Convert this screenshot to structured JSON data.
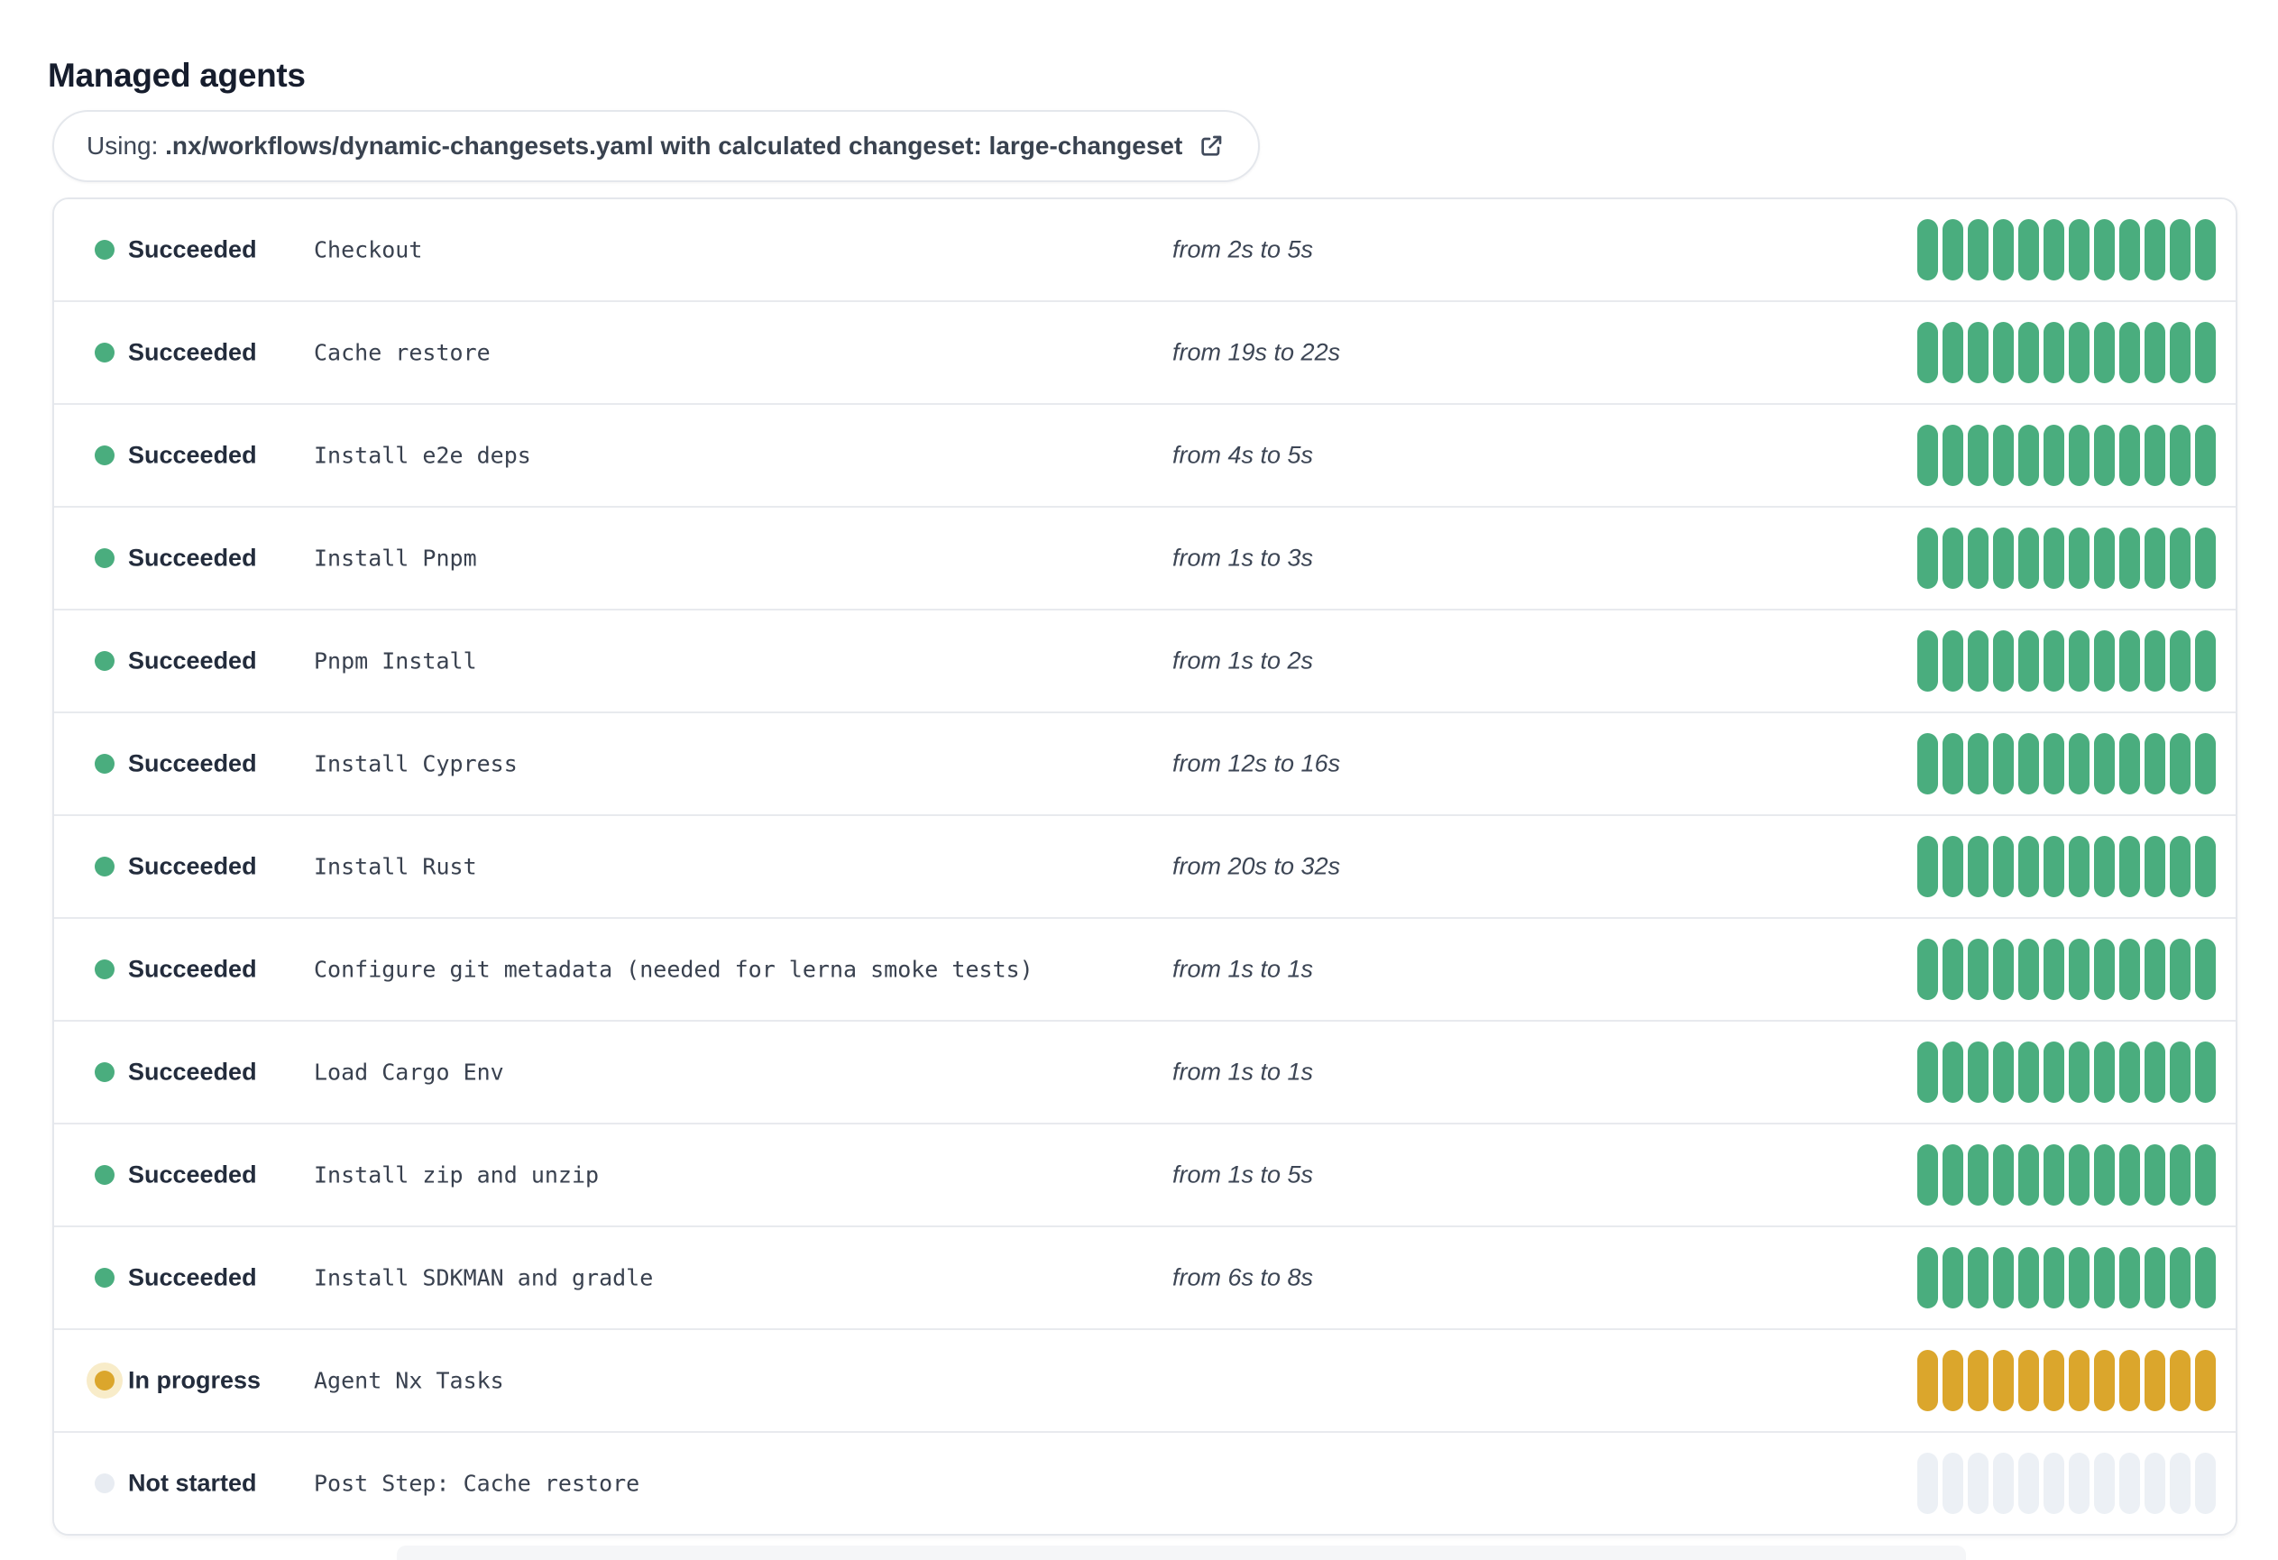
{
  "page": {
    "title": "Managed agents"
  },
  "banner": {
    "prefix": "Using: ",
    "detail": ".nx/workflows/dynamic-changesets.yaml with calculated changeset: large-changeset",
    "icon": "external-link-icon"
  },
  "agents": {
    "segments_per_row": 12,
    "rows": [
      {
        "status_label": "Succeeded",
        "status": "succeeded",
        "step": "Checkout",
        "duration": "from 2s to 5s"
      },
      {
        "status_label": "Succeeded",
        "status": "succeeded",
        "step": "Cache restore",
        "duration": "from 19s to 22s"
      },
      {
        "status_label": "Succeeded",
        "status": "succeeded",
        "step": "Install e2e deps",
        "duration": "from 4s to 5s"
      },
      {
        "status_label": "Succeeded",
        "status": "succeeded",
        "step": "Install Pnpm",
        "duration": "from 1s to 3s"
      },
      {
        "status_label": "Succeeded",
        "status": "succeeded",
        "step": "Pnpm Install",
        "duration": "from 1s to 2s"
      },
      {
        "status_label": "Succeeded",
        "status": "succeeded",
        "step": "Install Cypress",
        "duration": "from 12s to 16s"
      },
      {
        "status_label": "Succeeded",
        "status": "succeeded",
        "step": "Install Rust",
        "duration": "from 20s to 32s"
      },
      {
        "status_label": "Succeeded",
        "status": "succeeded",
        "step": "Configure git metadata (needed for lerna smoke tests)",
        "duration": "from 1s to 1s"
      },
      {
        "status_label": "Succeeded",
        "status": "succeeded",
        "step": "Load Cargo Env",
        "duration": "from 1s to 1s"
      },
      {
        "status_label": "Succeeded",
        "status": "succeeded",
        "step": "Install zip and unzip",
        "duration": "from 1s to 5s"
      },
      {
        "status_label": "Succeeded",
        "status": "succeeded",
        "step": "Install SDKMAN and gradle",
        "duration": "from 6s to 8s"
      },
      {
        "status_label": "In progress",
        "status": "in_progress",
        "step": "Agent Nx Tasks",
        "duration": ""
      },
      {
        "status_label": "Not started",
        "status": "not_started",
        "step": "Post Step: Cache restore",
        "duration": ""
      }
    ]
  },
  "colors": {
    "succeeded": "#4aad7e",
    "in-progress": "#dba62c",
    "in-progress-halo": "#f8ecc9",
    "not-started": "#ecf0f5",
    "not-started-dot": "#e8ecf2",
    "text-dark": "#161d2d",
    "text-slate": "#3d4655",
    "border": "#e4e7ec",
    "divider": "#e8eaee"
  }
}
